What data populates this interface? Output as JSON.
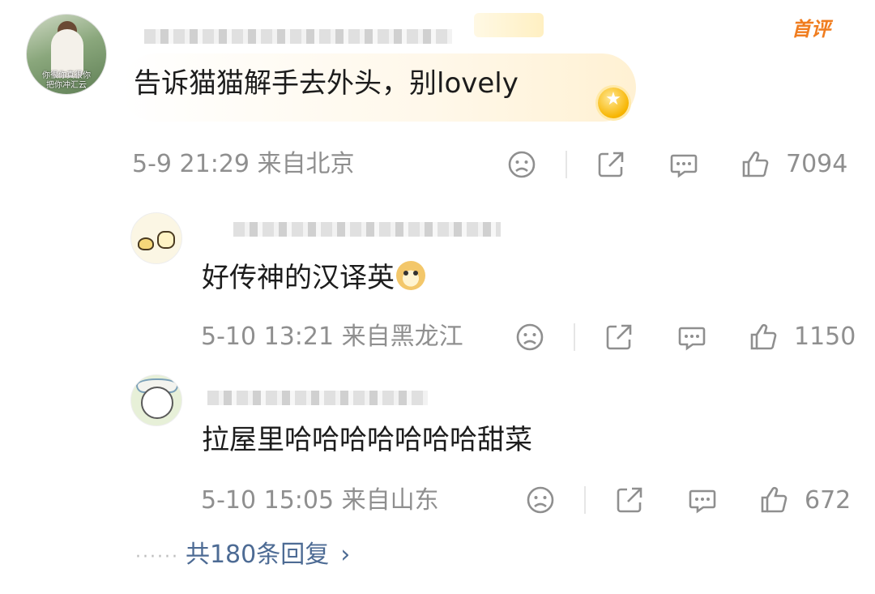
{
  "comment": {
    "badge_first": "首评",
    "text": "告诉猫猫解手去外头，别lovely",
    "avatar_caption": [
      "你很你真很你",
      "把你冲汇云"
    ],
    "time": "5-9 21:29",
    "location": "来自北京",
    "likes": "7094"
  },
  "replies": [
    {
      "text": "好传神的汉译英",
      "time": "5-10 13:21",
      "location": "来自黑龙江",
      "likes": "1150"
    },
    {
      "text": "拉屋里哈哈哈哈哈哈哈甜菜",
      "time": "5-10 15:05",
      "location": "来自山东",
      "likes": "672"
    }
  ],
  "more_replies": {
    "dots": "······",
    "label": "共180条回复",
    "chevron": "›"
  },
  "icons": [
    "sad-face-icon",
    "share-icon",
    "comment-icon",
    "thumbs-up-icon",
    "doge-emoji-icon",
    "crown-medal-icon"
  ],
  "colors": {
    "meta_gray": "#8f8f8f",
    "link_blue": "#4d6b94",
    "first_badge_orange": "#f07d1f",
    "bubble_gold": "#fff1d3"
  }
}
